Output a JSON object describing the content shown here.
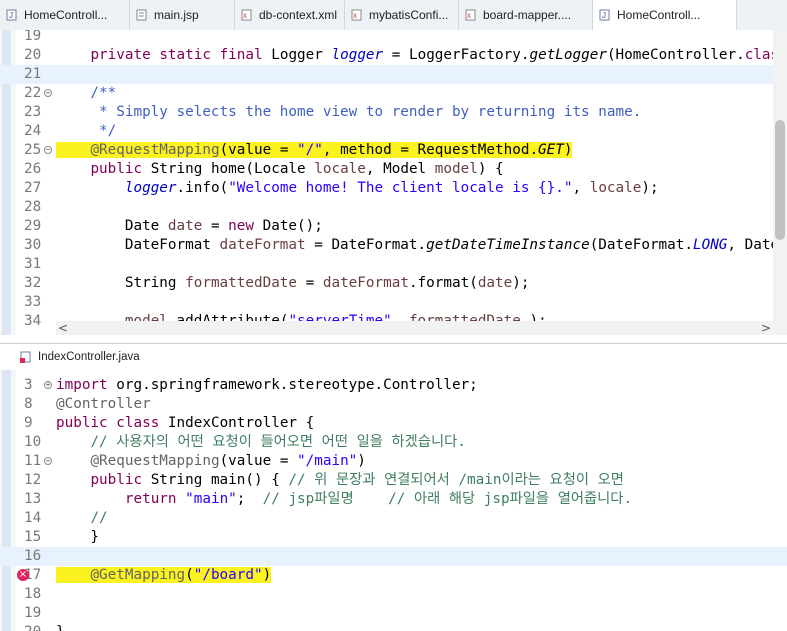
{
  "tabs": [
    {
      "label": "HomeControll...",
      "icon": "java-file-icon",
      "active": false
    },
    {
      "label": "main.jsp",
      "icon": "jsp-file-icon",
      "active": false
    },
    {
      "label": "db-context.xml",
      "icon": "xml-file-icon",
      "active": false
    },
    {
      "label": "mybatisConfi...",
      "icon": "xml-file-icon",
      "active": false
    },
    {
      "label": "board-mapper....",
      "icon": "xml-file-icon",
      "active": false
    },
    {
      "label": "HomeControll...",
      "icon": "java-file-icon",
      "active": true
    }
  ],
  "editor1": {
    "lines": [
      {
        "n": "19",
        "html": ""
      },
      {
        "n": "20",
        "text": "    private static final Logger logger = LoggerFactory.getLogger(HomeController.class);"
      },
      {
        "n": "21",
        "text": ""
      },
      {
        "n": "22",
        "text": "    /**",
        "fold": "−"
      },
      {
        "n": "23",
        "text": "     * Simply selects the home view to render by returning its name."
      },
      {
        "n": "24",
        "text": "     */"
      },
      {
        "n": "25",
        "text": "    @RequestMapping(value = \"/\", method = RequestMethod.GET)",
        "fold": "−"
      },
      {
        "n": "26",
        "text": "    public String home(Locale locale, Model model) {"
      },
      {
        "n": "27",
        "text": "        logger.info(\"Welcome home! The client locale is {}.\", locale);"
      },
      {
        "n": "28",
        "text": ""
      },
      {
        "n": "29",
        "text": "        Date date = new Date();"
      },
      {
        "n": "30",
        "text": "        DateFormat dateFormat = DateFormat.getDateTimeInstance(DateFormat.LONG, DateFormat"
      },
      {
        "n": "31",
        "text": ""
      },
      {
        "n": "32",
        "text": "        String formattedDate = dateFormat.format(date);"
      },
      {
        "n": "33",
        "text": ""
      },
      {
        "n": "34",
        "text": "        model.addAttribute(\"serverTime\", formattedDate );"
      }
    ]
  },
  "editor2": {
    "tab_label": "IndexController.java",
    "lines": [
      {
        "n": "3",
        "text": "import org.springframework.stereotype.Controller;",
        "fold": "+"
      },
      {
        "n": "8",
        "text": "@Controller"
      },
      {
        "n": "9",
        "text": "public class IndexController {"
      },
      {
        "n": "10",
        "text": "    // 사용자의 어떤 요청이 들어오면 어떤 일을 하겠습니다."
      },
      {
        "n": "11",
        "text": "    @RequestMapping(value = \"/main\")",
        "fold": "−"
      },
      {
        "n": "12",
        "text": "    public String main() { // 위 문장과 연결되어서 /main이라는 요청이 오면"
      },
      {
        "n": "13",
        "text": "        return \"main\";  // jsp파일명    // 아래 해당 jsp파일을 열어줍니다."
      },
      {
        "n": "14",
        "text": "    //"
      },
      {
        "n": "15",
        "text": "    }"
      },
      {
        "n": "16",
        "text": "    "
      },
      {
        "n": "17",
        "text": "    @GetMapping(\"/board\")"
      },
      {
        "n": "18",
        "text": ""
      },
      {
        "n": "19",
        "text": ""
      },
      {
        "n": "20",
        "text": "}"
      }
    ]
  },
  "colors": {
    "highlight": "#fcf21f",
    "keyword": "#7f0055",
    "string": "#2a00ff",
    "comment": "#3f7f5f",
    "javadoc": "#3f5fbf",
    "field": "#0000c0"
  }
}
